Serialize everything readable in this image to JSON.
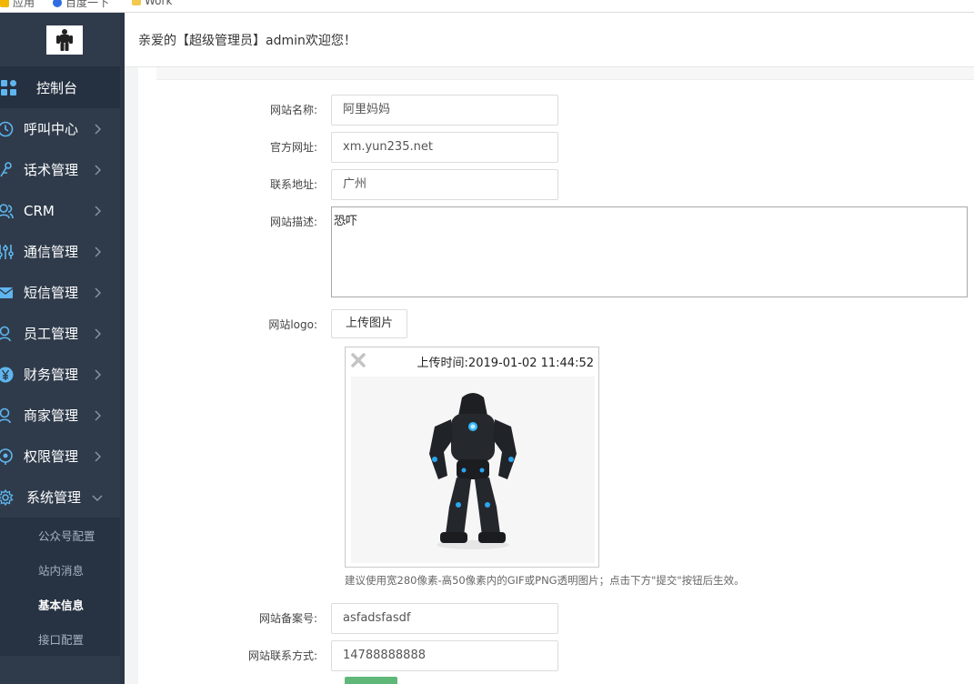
{
  "bookmarks": [
    {
      "label": "应用"
    },
    {
      "label": "百度一下"
    },
    {
      "label": "Work"
    }
  ],
  "sidebar": {
    "items": [
      {
        "label": "控制台",
        "icon": "dashboard-icon"
      },
      {
        "label": "呼叫中心",
        "icon": "clock-icon"
      },
      {
        "label": "话术管理",
        "icon": "script-icon"
      },
      {
        "label": "CRM",
        "icon": "users-icon"
      },
      {
        "label": "通信管理",
        "icon": "sliders-icon"
      },
      {
        "label": "短信管理",
        "icon": "envelope-icon"
      },
      {
        "label": "员工管理",
        "icon": "user-icon"
      },
      {
        "label": "财务管理",
        "icon": "yen-icon"
      },
      {
        "label": "商家管理",
        "icon": "merchant-icon"
      },
      {
        "label": "权限管理",
        "icon": "permission-icon"
      },
      {
        "label": "系统管理",
        "icon": "gear-icon"
      }
    ],
    "submenu": [
      {
        "label": "公众号配置"
      },
      {
        "label": "站内消息"
      },
      {
        "label": "基本信息",
        "active": true
      },
      {
        "label": "接口配置"
      }
    ]
  },
  "header": {
    "welcome": "亲爱的【超级管理员】admin欢迎您！"
  },
  "form": {
    "site_name": {
      "label": "网站名称:",
      "value": "阿里妈妈"
    },
    "official_url": {
      "label": "官方网址:",
      "value": "xm.yun235.net"
    },
    "address": {
      "label": "联系地址:",
      "value": "广州"
    },
    "description": {
      "label": "网站描述:",
      "value": "恐吓"
    },
    "logo": {
      "label": "网站logo:",
      "upload_button": "上传图片",
      "upload_time": "上传时间:2019-01-02 11:44:52",
      "hint": "建议使用宽280像素-高50像素内的GIF或PNG透明图片；点击下方\"提交\"按钮后生效。"
    },
    "icp": {
      "label": "网站备案号:",
      "value": "asfadsfasdf"
    },
    "contact": {
      "label": "网站联系方式:",
      "value": "14788888888"
    }
  },
  "colors": {
    "sidebar_bg": "#2f3b4b",
    "sidebar_icon": "#5fb6ef",
    "submit_green": "#5fb878"
  }
}
